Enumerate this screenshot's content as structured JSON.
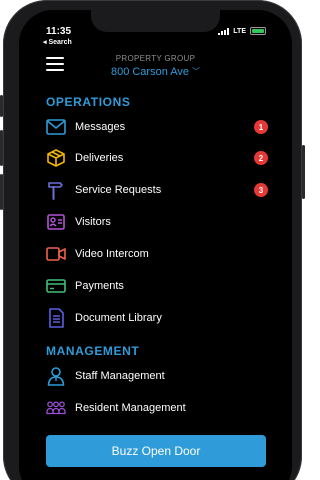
{
  "status_bar": {
    "time": "11:35",
    "back_link": "◂ Search",
    "network": "LTE"
  },
  "header": {
    "menu_icon": "hamburger-icon",
    "group_label": "PROPERTY GROUP",
    "property_name": "800 Carson Ave"
  },
  "operations": {
    "title": "OPERATIONS",
    "items": [
      {
        "label": "Messages",
        "icon": "envelope-icon",
        "badge": "1"
      },
      {
        "label": "Deliveries",
        "icon": "package-icon",
        "badge": "2"
      },
      {
        "label": "Service Requests",
        "icon": "hammer-icon",
        "badge": "3"
      },
      {
        "label": "Visitors",
        "icon": "id-card-icon"
      },
      {
        "label": "Video Intercom",
        "icon": "video-camera-icon"
      },
      {
        "label": "Payments",
        "icon": "credit-card-icon"
      },
      {
        "label": "Document Library",
        "icon": "document-icon"
      }
    ]
  },
  "management": {
    "title": "MANAGEMENT",
    "items": [
      {
        "label": "Staff Management",
        "icon": "staff-icon"
      },
      {
        "label": "Resident Management",
        "icon": "residents-icon"
      }
    ]
  },
  "actions": {
    "buzz_label": "Buzz Open Door"
  },
  "colors": {
    "accent": "#2f9bd8",
    "badge": "#e53935",
    "background": "#000000",
    "envelope": "#2f9bd8",
    "package": "#f2b705",
    "hammer": "#6b6fd9",
    "visitors": "#b653d8",
    "video": "#f0634a",
    "payments": "#3fbf7a",
    "document": "#5a5fe0",
    "staff": "#2f9bd8",
    "residents": "#9b4fd6"
  }
}
